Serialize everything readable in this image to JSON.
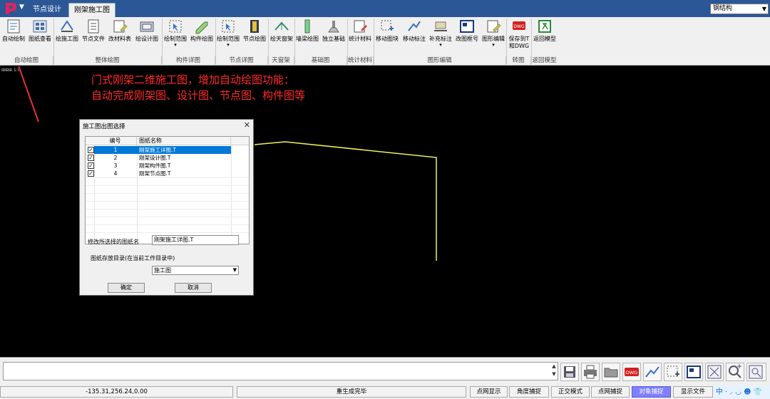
{
  "titlebar": {
    "tabs": [
      "节点设计",
      "刚架施工图"
    ],
    "structure_select": "钢结构"
  },
  "ribbon": {
    "buttons": [
      {
        "label": "自动绘制"
      },
      {
        "label": "图纸查看"
      },
      {
        "label": "绘施工图"
      },
      {
        "label": "节点文件"
      },
      {
        "label": "改材料表"
      },
      {
        "label": "绘设计图"
      },
      {
        "label": "绘制范围"
      },
      {
        "label": "构件绘图"
      },
      {
        "label": "绘制范围"
      },
      {
        "label": "节点绘图"
      },
      {
        "label": "绘天窗架"
      },
      {
        "label": "墙梁绘图"
      },
      {
        "label": "独立基础"
      },
      {
        "label": "统计材料"
      },
      {
        "label": "移动图块"
      },
      {
        "label": "移动标注"
      },
      {
        "label": "补充标注"
      },
      {
        "label": "改图框号"
      },
      {
        "label": "图形编辑"
      },
      {
        "label": "保存到T",
        "label2": "和DWG"
      },
      {
        "label": "返回模型"
      }
    ],
    "groups": [
      "自动绘图",
      "整体绘图",
      "构件详图",
      "节点详图",
      "天窗架",
      "基础图",
      "统计材料",
      "图形编辑",
      "转图",
      "返回模型"
    ]
  },
  "canvas": {
    "coord_mark": "⊞⊞⊞ 1:0",
    "annotation_line1": "门式刚架二维施工图，增加自动绘图功能：",
    "annotation_line2": "自动完成刚架图、设计图、节点图、构件图等",
    "frame_color": "#f2f25a",
    "annotation_color": "#ff2b2b"
  },
  "dialog": {
    "title": "施工图出图选择",
    "close": "✕",
    "columns": [
      "编号",
      "图纸名称"
    ],
    "rows": [
      {
        "no": "1",
        "name": "刚架施工详图.T",
        "checked": true,
        "selected": true
      },
      {
        "no": "2",
        "name": "刚架设计图.T",
        "checked": true,
        "selected": false
      },
      {
        "no": "3",
        "name": "刚架构件图.T",
        "checked": true,
        "selected": false
      },
      {
        "no": "4",
        "name": "刚架节点图.T",
        "checked": true,
        "selected": false
      }
    ],
    "rename_label": "修改所选择的图纸名",
    "rename_value": "刚架施工详图.T",
    "dir_label": "图纸存放目录(在当前工作目录中)",
    "dir_value": "施工图",
    "ok_label": "确定",
    "cancel_label": "取消"
  },
  "statusbar": {
    "coord": "-135.31,256.24,0.00",
    "message": "重生成完毕",
    "point_display": "点网显示",
    "angle_snap": "角度捕捉",
    "ortho": "正交模式",
    "point_snap": "点网捕捉",
    "object_snap": "对象捕捉",
    "show": "显示文件",
    "ime": "中 ⸱ ⸝ ◡ ☻ 👕"
  }
}
